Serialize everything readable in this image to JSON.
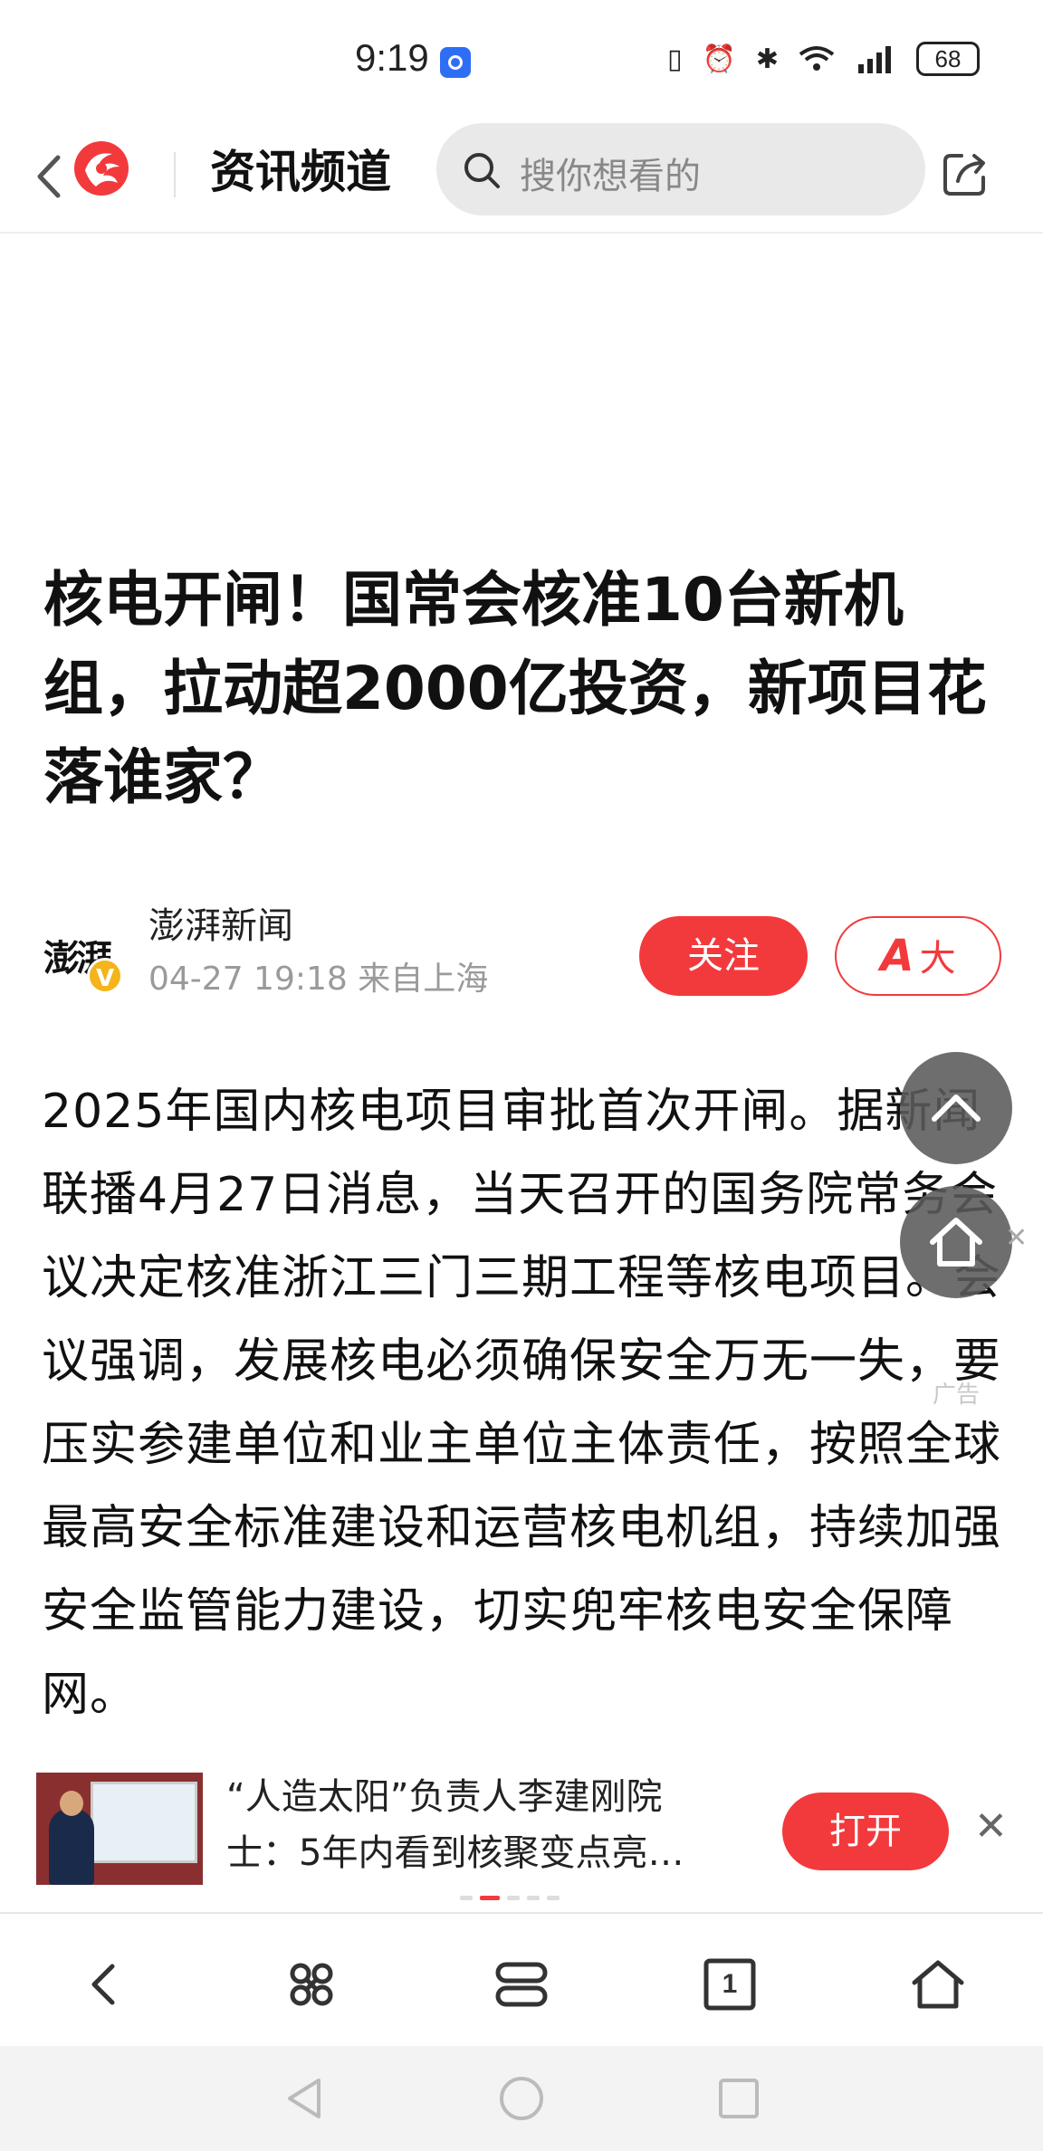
{
  "status_bar": {
    "time": "9:19",
    "battery": "68",
    "icons": [
      "nfc-icon",
      "alarm-icon",
      "bluetooth-icon",
      "wifi-icon",
      "signal-4g-icon"
    ]
  },
  "top_nav": {
    "channel_title": "资讯频道",
    "search_placeholder": "搜你想看的",
    "brand_color": "#f23a3c"
  },
  "article": {
    "headline": "核电开闸！国常会核准10台新机组，拉动超2000亿投资，新项目花落谁家？",
    "author_name": "澎湃新闻",
    "avatar_text": "澎湃",
    "verified_mark": "V",
    "meta": "04-27 19:18 来自上海",
    "follow_label": "关注",
    "font_size_label_a": "A",
    "font_size_label": "大",
    "body": "2025年国内核电项目审批首次开闸。据新闻联播4月27日消息，当天召开的国务院常务会议决定核准浙江三门三期工程等核电项目。会议强调，发展核电必须确保安全万无一失，要压实参建单位和业主单位主体责任，按照全球最高安全标准建设和运营核电机组，持续加强安全监管能力建设，切实兜牢核电安全保障网。"
  },
  "floating": {
    "ad_label": "广告"
  },
  "promo": {
    "title": "“人造太阳”负责人李建刚院士：5年内看到核聚变点亮…",
    "open_label": "打开",
    "close_symbol": "✕",
    "page_count": 5,
    "active_page": 2
  },
  "toolbar": {
    "current_tab_count": "1",
    "items": [
      "back-icon",
      "menu-icon",
      "tabs-stack-icon",
      "tab-count-icon",
      "home-icon"
    ]
  },
  "system_nav": {
    "items": [
      "nav-back-icon",
      "nav-home-icon",
      "nav-recents-icon"
    ]
  }
}
